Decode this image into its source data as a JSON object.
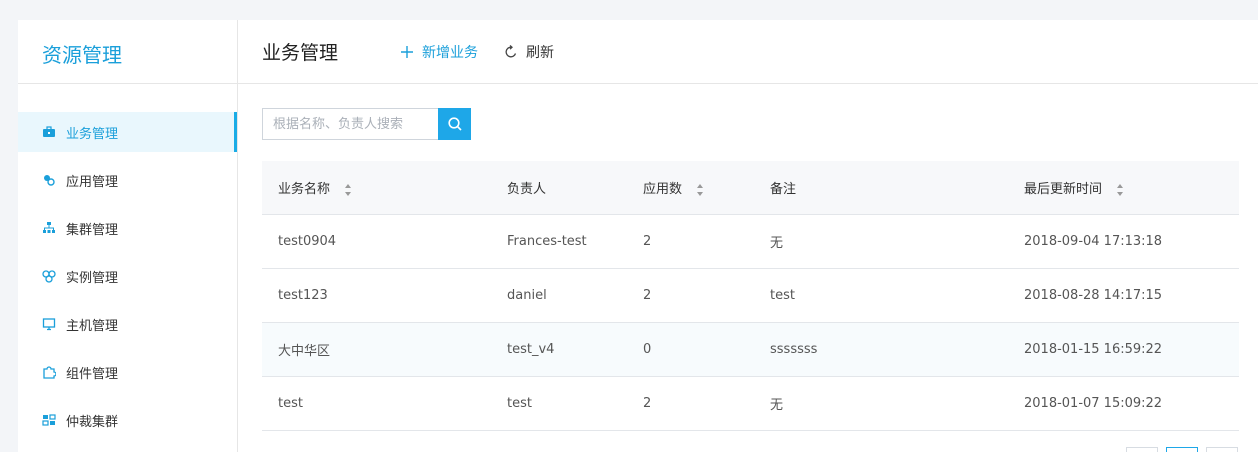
{
  "sidebar": {
    "title": "资源管理",
    "items": [
      {
        "label": "业务管理",
        "icon": "briefcase-icon",
        "active": true
      },
      {
        "label": "应用管理",
        "icon": "apps-icon",
        "active": false
      },
      {
        "label": "集群管理",
        "icon": "cluster-icon",
        "active": false
      },
      {
        "label": "实例管理",
        "icon": "instances-icon",
        "active": false
      },
      {
        "label": "主机管理",
        "icon": "monitor-icon",
        "active": false
      },
      {
        "label": "组件管理",
        "icon": "puzzle-icon",
        "active": false
      },
      {
        "label": "仲裁集群",
        "icon": "arbiter-icon",
        "active": false
      }
    ]
  },
  "header": {
    "title": "业务管理",
    "add_label": "新增业务",
    "refresh_label": "刷新"
  },
  "search": {
    "placeholder": "根据名称、负责人搜索",
    "value": ""
  },
  "table": {
    "columns": [
      "业务名称",
      "负责人",
      "应用数",
      "备注",
      "最后更新时间"
    ],
    "rows": [
      [
        "test0904",
        "Frances-test",
        "2",
        "无",
        "2018-09-04 17:13:18"
      ],
      [
        "test123",
        "daniel",
        "2",
        "test",
        "2018-08-28 14:17:15"
      ],
      [
        "大中华区",
        "test_v4",
        "0",
        "sssssss",
        "2018-01-15 16:59:22"
      ],
      [
        "test",
        "test",
        "2",
        "无",
        "2018-01-07 15:09:22"
      ]
    ]
  },
  "colors": {
    "accent": "#1a9fda",
    "search_button": "#1ea7e8",
    "active_bg": "#e9f7fd"
  }
}
